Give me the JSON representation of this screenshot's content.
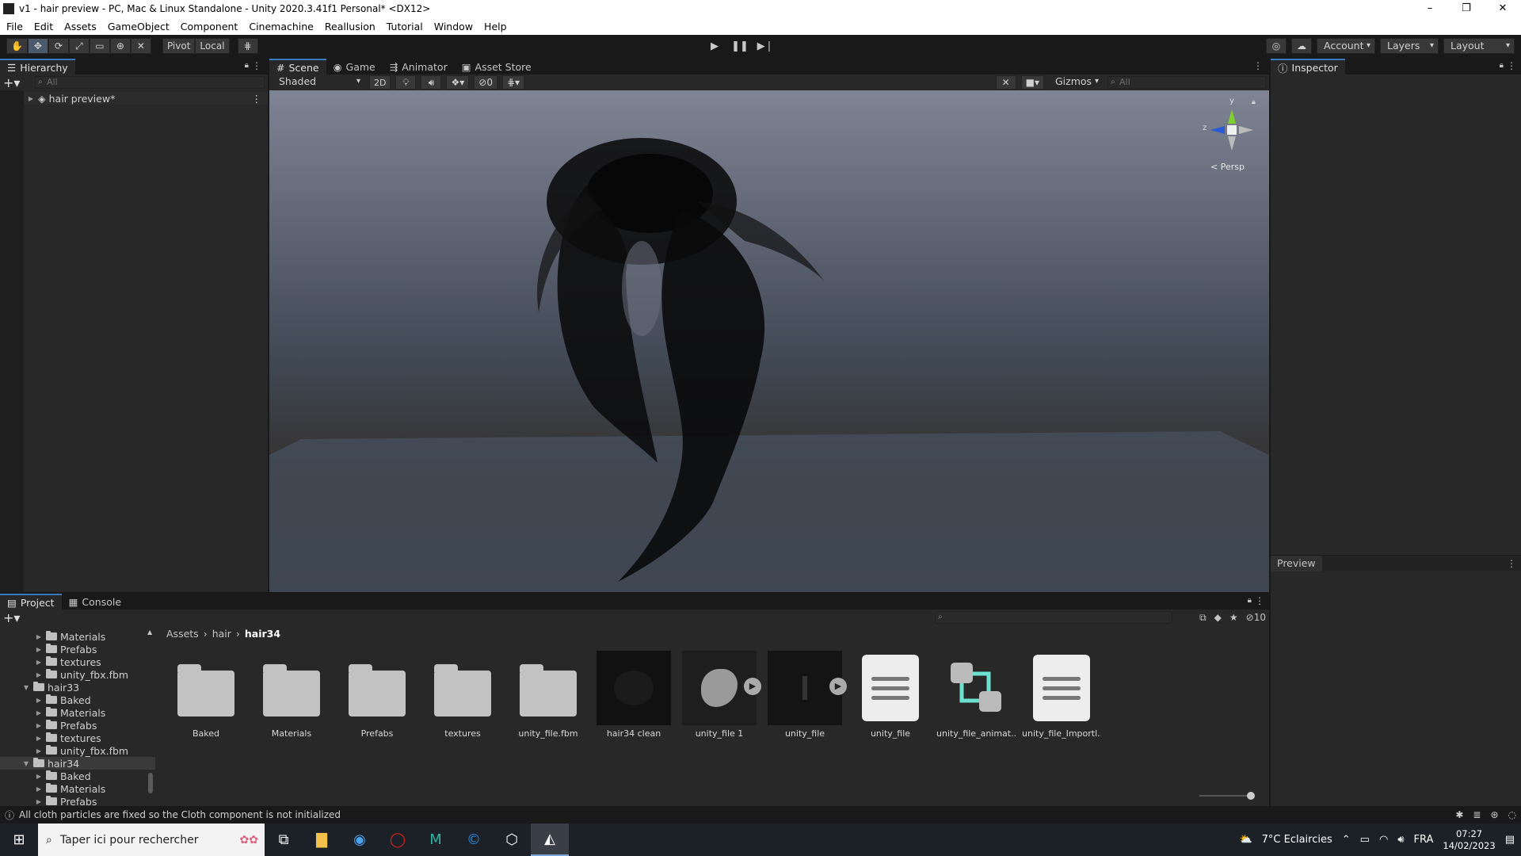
{
  "window": {
    "title": "v1 - hair preview - PC, Mac & Linux Standalone - Unity 2020.3.41f1 Personal* <DX12>",
    "controls": [
      "–",
      "❐",
      "✕"
    ]
  },
  "menu": [
    "File",
    "Edit",
    "Assets",
    "GameObject",
    "Component",
    "Cinemachine",
    "Reallusion",
    "Tutorial",
    "Window",
    "Help"
  ],
  "toolbar": {
    "pivot": "Pivot",
    "local": "Local",
    "account": "Account",
    "layers": "Layers",
    "layout": "Layout"
  },
  "hierarchy": {
    "tab": "Hierarchy",
    "search_placeholder": "All",
    "root_item": "hair preview*"
  },
  "scene": {
    "tabs": [
      "Scene",
      "Game",
      "Animator",
      "Asset Store"
    ],
    "shading": "Shaded",
    "mode_2d": "2D",
    "hidden_count": "0",
    "gizmos": "Gizmos",
    "search_placeholder": "All",
    "gizmo_axes": {
      "y": "y",
      "z": "z"
    },
    "persp": "< Persp"
  },
  "inspector": {
    "tab": "Inspector",
    "preview": "Preview"
  },
  "project": {
    "tabs": [
      "Project",
      "Console"
    ],
    "hidden_count": "10",
    "breadcrumb": [
      "Assets",
      "hair",
      "hair34"
    ],
    "tree": [
      {
        "label": "Materials",
        "indent": 2,
        "expanded": false
      },
      {
        "label": "Prefabs",
        "indent": 2,
        "expanded": false
      },
      {
        "label": "textures",
        "indent": 2,
        "expanded": false
      },
      {
        "label": "unity_fbx.fbm",
        "indent": 2,
        "expanded": false
      },
      {
        "label": "hair33",
        "indent": 1,
        "expanded": true
      },
      {
        "label": "Baked",
        "indent": 2,
        "expanded": false
      },
      {
        "label": "Materials",
        "indent": 2,
        "expanded": false
      },
      {
        "label": "Prefabs",
        "indent": 2,
        "expanded": false
      },
      {
        "label": "textures",
        "indent": 2,
        "expanded": false
      },
      {
        "label": "unity_fbx.fbm",
        "indent": 2,
        "expanded": false
      },
      {
        "label": "hair34",
        "indent": 1,
        "expanded": true,
        "selected": true
      },
      {
        "label": "Baked",
        "indent": 2,
        "expanded": false
      },
      {
        "label": "Materials",
        "indent": 2,
        "expanded": false
      },
      {
        "label": "Prefabs",
        "indent": 2,
        "expanded": false
      }
    ],
    "assets": [
      {
        "label": "Baked",
        "type": "folder"
      },
      {
        "label": "Materials",
        "type": "folder"
      },
      {
        "label": "Prefabs",
        "type": "folder"
      },
      {
        "label": "textures",
        "type": "folder"
      },
      {
        "label": "unity_file.fbm",
        "type": "folder"
      },
      {
        "label": "hair34 clean",
        "type": "material"
      },
      {
        "label": "unity_file 1",
        "type": "model"
      },
      {
        "label": "unity_file",
        "type": "model-dark"
      },
      {
        "label": "unity_file",
        "type": "doc"
      },
      {
        "label": "unity_file_animat...",
        "type": "animator"
      },
      {
        "label": "unity_file_Importl...",
        "type": "doc"
      }
    ]
  },
  "status": {
    "message": "All cloth particles are fixed so the Cloth component is not initialized"
  },
  "taskbar": {
    "search_placeholder": "Taper ici pour rechercher",
    "weather": "7°C Eclaircies",
    "language": "FRA",
    "time": "07:27",
    "date": "14/02/2023"
  },
  "colors": {
    "editor_bg": "#282828",
    "accent": "#3a79bb",
    "selection": "#2c5d87"
  }
}
